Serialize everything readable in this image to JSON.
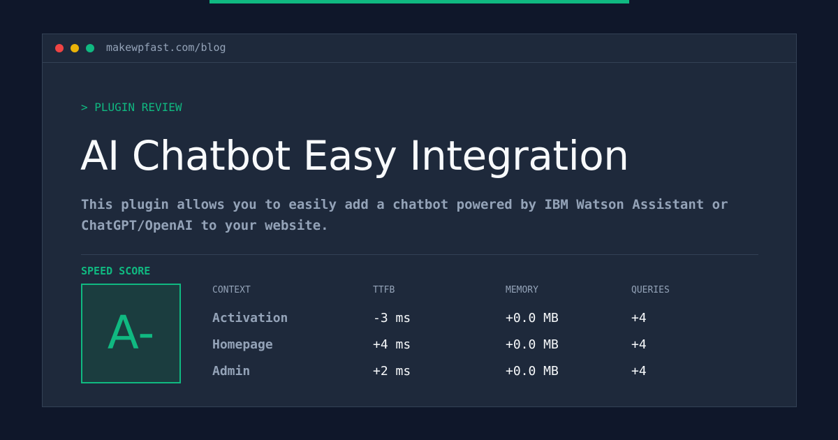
{
  "page": {
    "accent_color": "#10b981",
    "background_color": "#0f172a",
    "window_color": "#1e293b"
  },
  "browser": {
    "url": "makewpfast.com/blog",
    "dots": [
      "close-dot",
      "minimize-dot",
      "maximize-dot"
    ]
  },
  "header": {
    "eyebrow": "> PLUGIN REVIEW",
    "title": "AI Chatbot Easy Integration"
  },
  "description": "This plugin allows you to easily add a chatbot powered by IBM Watson Assistant or ChatGPT/OpenAI to your website.",
  "score": {
    "label": "SPEED SCORE",
    "grade": "A-"
  },
  "table": {
    "headers": [
      "CONTEXT",
      "TTFB",
      "MEMORY",
      "QUERIES"
    ],
    "rows": [
      {
        "context": "Activation",
        "ttfb": "-3 ms",
        "memory": "+0.0 MB",
        "queries": "+4"
      },
      {
        "context": "Homepage",
        "ttfb": "+4 ms",
        "memory": "+0.0 MB",
        "queries": "+4"
      },
      {
        "context": "Admin",
        "ttfb": "+2 ms",
        "memory": "+0.0 MB",
        "queries": "+4"
      }
    ]
  }
}
